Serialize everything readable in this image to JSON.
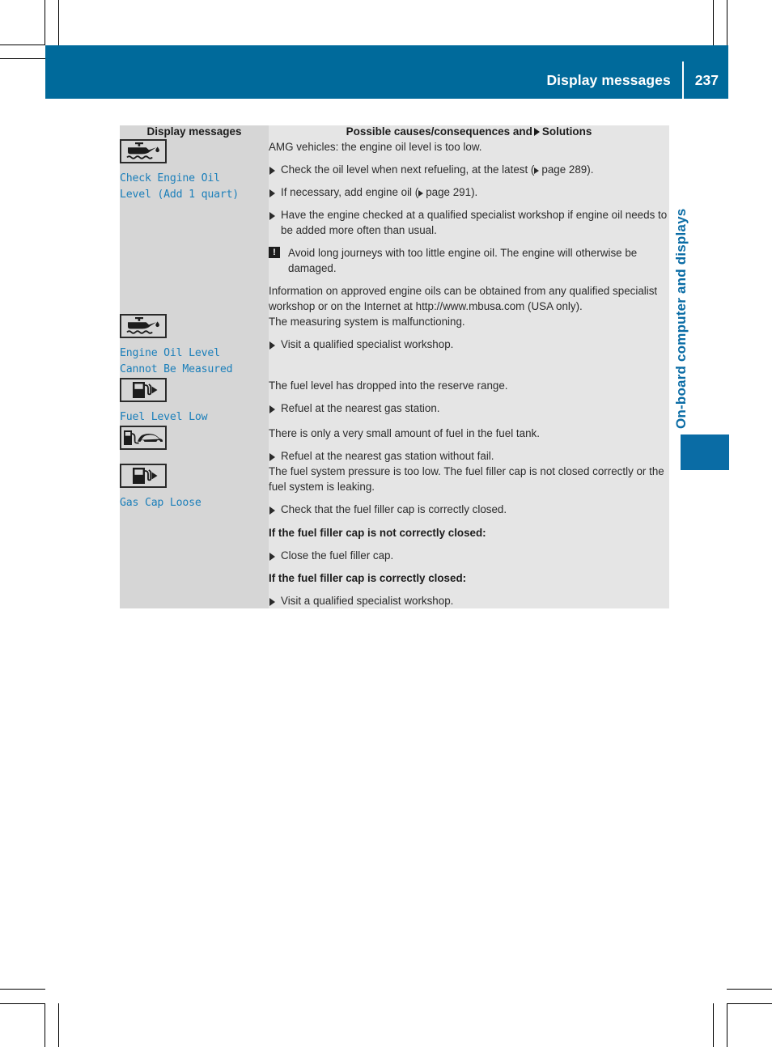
{
  "header": {
    "title": "Display messages",
    "page_number": "237"
  },
  "side_tab": {
    "label": "On-board computer and displays"
  },
  "table": {
    "columns": {
      "left": "Display messages",
      "right_prefix": "Possible causes/consequences and",
      "right_suffix": "Solutions"
    },
    "rows": [
      {
        "icon": "oil-can-low-level-icon",
        "message": "Check Engine Oil\nLevel (Add 1 quart)",
        "blocks": [
          {
            "kind": "para",
            "text": "AMG vehicles: the engine oil level is too low."
          },
          {
            "kind": "bullet",
            "text": "Check the oil level when next refueling, at the latest (",
            "pageref": "page 289",
            "text_after": ")."
          },
          {
            "kind": "bullet",
            "text": "If necessary, add engine oil (",
            "pageref": "page 291",
            "text_after": ")."
          },
          {
            "kind": "bullet",
            "text": "Have the engine checked at a qualified specialist workshop if engine oil needs to be added more often than usual."
          },
          {
            "kind": "note",
            "badge": "!",
            "text": "Avoid long journeys with too little engine oil. The engine will otherwise be damaged."
          },
          {
            "kind": "para",
            "text": "Information on approved engine oils can be obtained from any qualified specialist workshop or on the Internet at http://www.mbusa.com (USA only)."
          }
        ]
      },
      {
        "icon": "oil-can-low-level-icon",
        "message": "Engine Oil Level\nCannot Be Measured",
        "blocks": [
          {
            "kind": "para",
            "text": "The measuring system is malfunctioning."
          },
          {
            "kind": "bullet",
            "text": "Visit a qualified specialist workshop."
          }
        ]
      },
      {
        "icon": "fuel-pump-icon",
        "message": "Fuel Level Low",
        "blocks": [
          {
            "kind": "para",
            "text": "The fuel level has dropped into the reserve range."
          },
          {
            "kind": "bullet",
            "text": "Refuel at the nearest gas station."
          }
        ]
      },
      {
        "icon": "fuel-pump-car-icon",
        "message": "",
        "blocks": [
          {
            "kind": "para",
            "text": "There is only a very small amount of fuel in the fuel tank."
          },
          {
            "kind": "bullet",
            "text": "Refuel at the nearest gas station without fail."
          }
        ]
      },
      {
        "icon": "fuel-pump-icon",
        "message": "Gas Cap Loose",
        "blocks": [
          {
            "kind": "para",
            "text": "The fuel system pressure is too low. The fuel filler cap is not closed correctly or the fuel system is leaking."
          },
          {
            "kind": "bullet",
            "text": "Check that the fuel filler cap is correctly closed."
          },
          {
            "kind": "para-bold",
            "text": "If the fuel filler cap is not correctly closed:"
          },
          {
            "kind": "bullet",
            "text": "Close the fuel filler cap."
          },
          {
            "kind": "para-bold",
            "text": "If the fuel filler cap is correctly closed:"
          },
          {
            "kind": "bullet",
            "text": "Visit a qualified specialist workshop."
          }
        ]
      }
    ]
  },
  "colors": {
    "header_blue": "#006a9b",
    "tab_blue": "#0a6ca5",
    "message_blue": "#1b7fba",
    "cell_left_gray": "#d6d6d6",
    "cell_right_gray": "#e5e5e5"
  }
}
